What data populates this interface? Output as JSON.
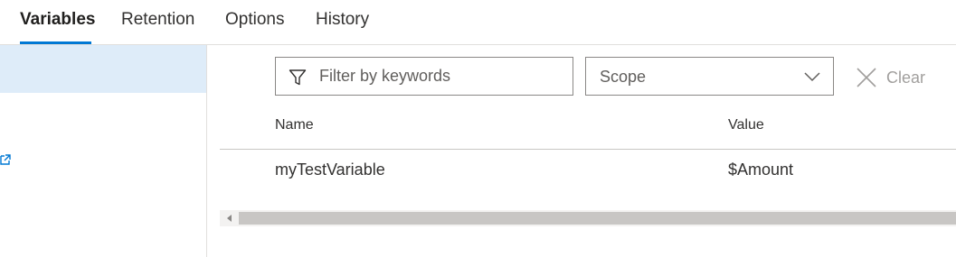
{
  "tabs": [
    {
      "label": "Variables",
      "active": true
    },
    {
      "label": "Retention",
      "active": false
    },
    {
      "label": "Options",
      "active": false
    },
    {
      "label": "History",
      "active": false
    }
  ],
  "toolbar": {
    "filter_placeholder": "Filter by keywords",
    "filter_value": "",
    "scope_label": "Scope",
    "clear_label": "Clear"
  },
  "table": {
    "columns": [
      "Name",
      "Value"
    ],
    "rows": [
      {
        "name": "myTestVariable",
        "value": "$Amount"
      }
    ]
  },
  "icons": {
    "filter": "filter-funnel-icon",
    "scope_dropdown": "chevron-down-icon",
    "clear": "close-icon",
    "left_pane_link": "external-link-icon"
  },
  "colors": {
    "accent": "#0078d4",
    "selected_bg": "#deecf9",
    "disabled_text": "#a19f9d"
  }
}
